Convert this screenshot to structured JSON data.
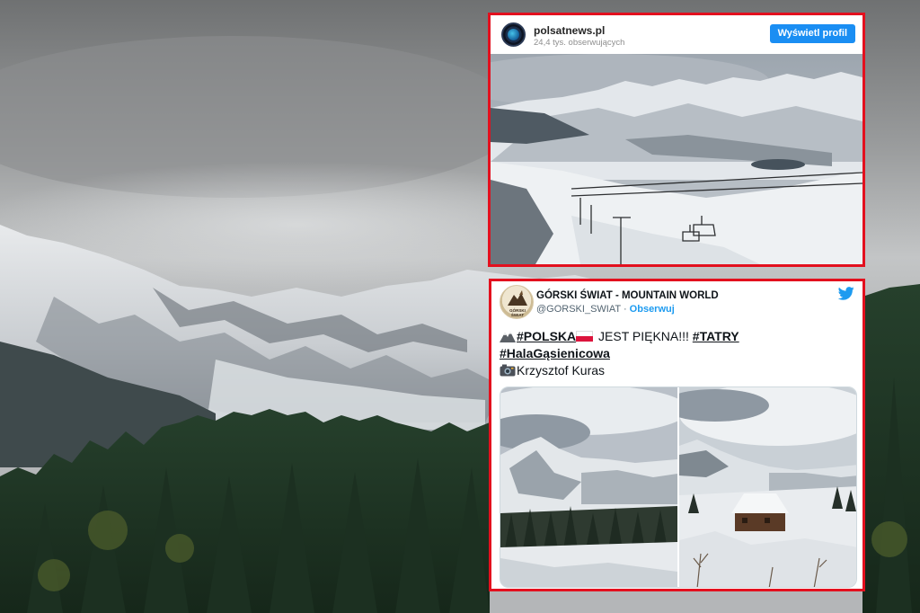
{
  "instagram": {
    "username": "polsatnews.pl",
    "followers": "24,4 tys. obserwujących",
    "view_profile_label": "Wyświetl profil"
  },
  "tweet": {
    "display_name": "GÓRSKI ŚWIAT - MOUNTAIN WORLD",
    "handle": "@GORSKI_SWIAT",
    "separator": " · ",
    "follow_label": "Obserwuj",
    "avatar_text_line1": "GÓRSKI",
    "avatar_text_line2": "ŚWIAT",
    "hashtag_polska": "#POLSKA",
    "text_middle": " JEST PIĘKNA!!! ",
    "hashtag_tatry": "#TATRY",
    "hashtag_hala": "#HalaGąsienicowa",
    "photo_credit": "Krzysztof Kuras"
  },
  "colors": {
    "frame_red": "#e3101e",
    "instagram_button": "#1a8ef3",
    "twitter_blue": "#1d9bf0"
  },
  "icons": [
    "instagram-avatar-logo",
    "mountain-emoji-icon",
    "poland-flag-icon",
    "camera-emoji-icon",
    "twitter-bird-icon"
  ]
}
